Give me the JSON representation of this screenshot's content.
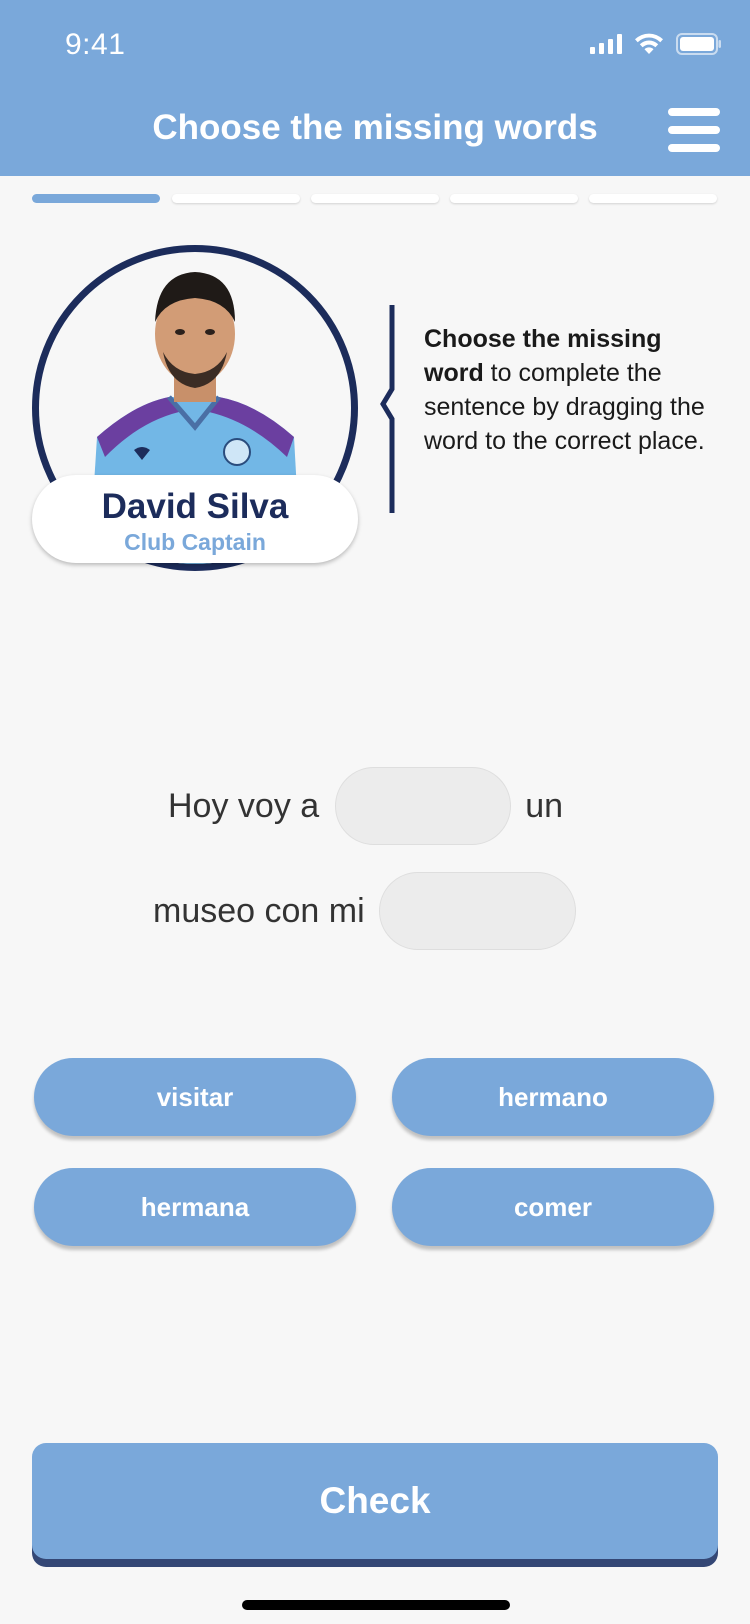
{
  "status_bar": {
    "time": "9:41"
  },
  "header": {
    "title": "Choose the missing words"
  },
  "progress": {
    "current_step": 1,
    "total_steps": 5
  },
  "player": {
    "name": "David Silva",
    "role": "Club Captain"
  },
  "instruction": {
    "bold": "Choose the missing word",
    "rest": " to complete the sentence by dragging the word to the correct place."
  },
  "sentence": {
    "line1_before": "Hoy voy a",
    "line1_after": "un",
    "line2_before": "museo con mi"
  },
  "options": [
    "visitar",
    "hermano",
    "hermana",
    "comer"
  ],
  "check_button": {
    "label": "Check"
  },
  "colors": {
    "accent": "#7aa8da",
    "navy": "#1c2c5b",
    "background": "#f7f7f7"
  }
}
